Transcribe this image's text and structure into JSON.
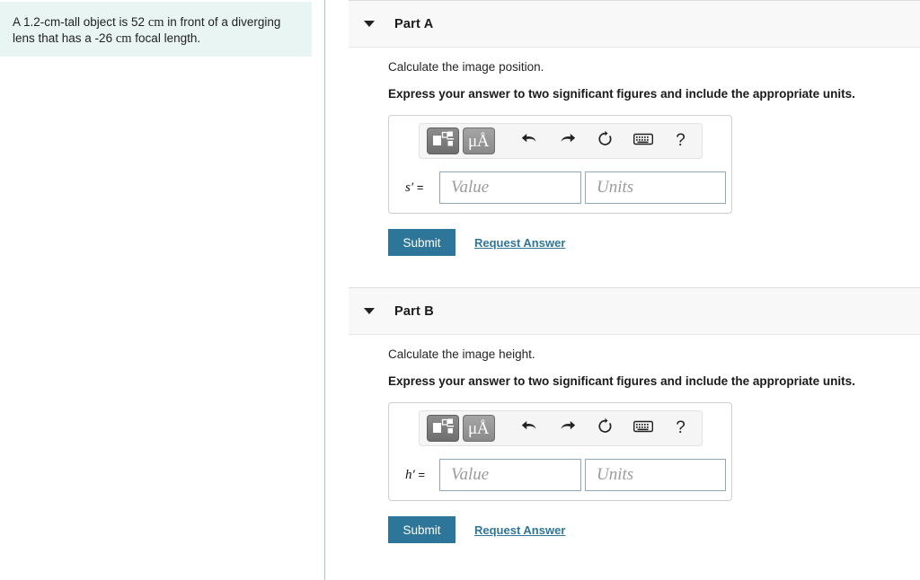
{
  "question": {
    "text_segments": [
      {
        "text": "A 1.2-cm-tall object is 52 ",
        "style": "plain"
      },
      {
        "text": "cm",
        "style": "serif"
      },
      {
        "text": " in front of a diverging lens that has a -26 ",
        "style": "plain"
      },
      {
        "text": "cm",
        "style": "serif"
      },
      {
        "text": " focal length.",
        "style": "plain"
      }
    ],
    "text_full": "A 1.2-cm-tall object is 52 cm in front of a diverging lens that has a -26 cm focal length.",
    "background_color": "#e9f5f3"
  },
  "colors": {
    "accent": "#2e7699",
    "question_bg": "#e9f5f3",
    "header_bg": "#f8f8f8",
    "divider": "#aec2ce",
    "input_border": "#8fa8b8",
    "placeholder_text": "#9b9b9b"
  },
  "toolbar": {
    "buttons": [
      {
        "name": "math-template-button",
        "label": "",
        "icon": "math-template-icon"
      },
      {
        "name": "unit-symbol-button",
        "label": "μÅ",
        "icon": "micro-angstrom-icon"
      },
      {
        "name": "undo-button",
        "label": "",
        "icon": "undo-arrow-icon"
      },
      {
        "name": "redo-button",
        "label": "",
        "icon": "redo-arrow-icon"
      },
      {
        "name": "reset-button",
        "label": "",
        "icon": "reset-circular-arrow-icon"
      },
      {
        "name": "keyboard-button",
        "label": "",
        "icon": "keyboard-icon"
      },
      {
        "name": "help-button",
        "label": "?",
        "icon": "question-mark-icon"
      }
    ],
    "unit_symbol": "μÅ",
    "help_symbol": "?"
  },
  "parts": [
    {
      "id": "part-a",
      "title": "Part A",
      "prompt": "Calculate the image position.",
      "instruction": "Express your answer to two significant figures and include the appropriate units.",
      "variable_symbol": "s",
      "variable_prime": "′",
      "equals": "=",
      "value_placeholder": "Value",
      "units_placeholder": "Units",
      "value_current": "",
      "units_current": "",
      "submit_label": "Submit",
      "request_answer_label": "Request Answer",
      "expanded": true
    },
    {
      "id": "part-b",
      "title": "Part B",
      "prompt": "Calculate the image height.",
      "instruction": "Express your answer to two significant figures and include the appropriate units.",
      "variable_symbol": "h",
      "variable_prime": "′",
      "equals": "=",
      "value_placeholder": "Value",
      "units_placeholder": "Units",
      "value_current": "",
      "units_current": "",
      "submit_label": "Submit",
      "request_answer_label": "Request Answer",
      "expanded": true
    }
  ]
}
